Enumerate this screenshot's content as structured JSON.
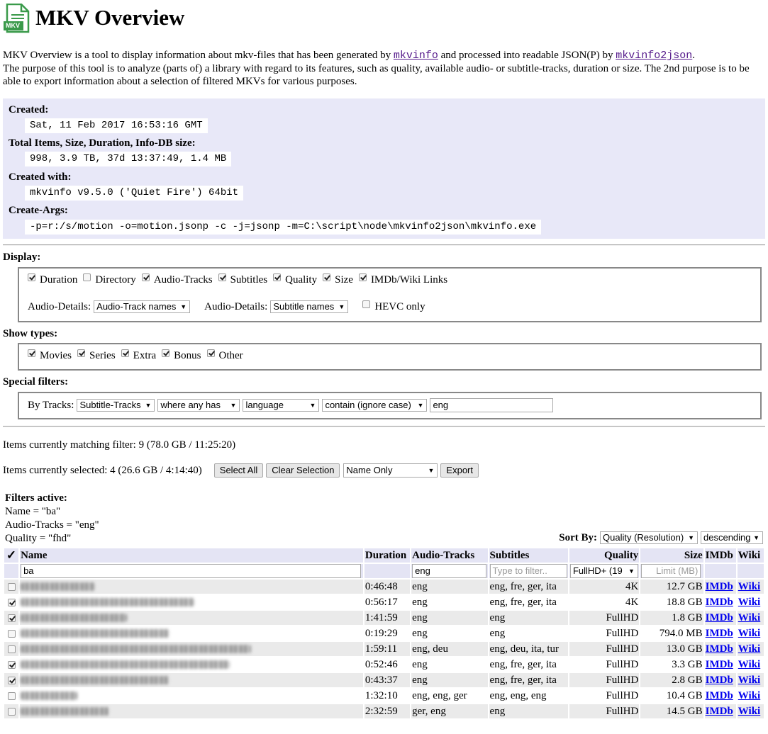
{
  "header": {
    "logo_text": "MKV",
    "title": "MKV Overview"
  },
  "intro": {
    "line1_prefix": "MKV Overview is a tool to display information about mkv-files that has been generated by ",
    "link1": "mkvinfo",
    "line1_mid": " and processed into readable JSON(P) by ",
    "link2": "mkvinfo2json",
    "line1_suffix": ".",
    "line2": "The purpose of this tool is to analyze (parts of) a library with regard to its features, such as quality, available audio- or subtitle-tracks, duration or size. The 2nd purpose is to be able to export information about a selection of filtered MKVs for various purposes."
  },
  "meta": {
    "created_label": "Created:",
    "created_value": "Sat, 11 Feb 2017 16:53:16 GMT",
    "totals_label": "Total Items, Size, Duration, Info-DB size:",
    "totals_value": "998, 3.9 TB, 37d 13:37:49, 1.4 MB",
    "with_label": "Created with:",
    "with_value": "mkvinfo v9.5.0 ('Quiet Fire') 64bit",
    "args_label": "Create-Args:",
    "args_value": "-p=r:/s/motion -o=motion.jsonp -c -j=jsonp -m=C:\\script\\node\\mkvinfo2json\\mkvinfo.exe"
  },
  "display": {
    "title": "Display:",
    "checks": [
      {
        "label": "Duration",
        "checked": true
      },
      {
        "label": "Directory",
        "checked": false
      },
      {
        "label": "Audio-Tracks",
        "checked": true
      },
      {
        "label": "Subtitles",
        "checked": true
      },
      {
        "label": "Quality",
        "checked": true
      },
      {
        "label": "Size",
        "checked": true
      },
      {
        "label": "IMDb/Wiki Links",
        "checked": true
      }
    ],
    "audio_details_label": "Audio-Details:",
    "audio_details_value": "Audio-Track names",
    "sub_details_label": "Audio-Details:",
    "sub_details_value": "Subtitle names",
    "hevc_label": "HEVC only"
  },
  "types": {
    "title": "Show types:",
    "checks": [
      {
        "label": "Movies",
        "checked": true
      },
      {
        "label": "Series",
        "checked": true
      },
      {
        "label": "Extra",
        "checked": true
      },
      {
        "label": "Bonus",
        "checked": true
      },
      {
        "label": "Other",
        "checked": true
      }
    ]
  },
  "special": {
    "title": "Special filters:",
    "by_label": "By Tracks:",
    "track_type": "Subtitle-Tracks",
    "where": "where any has",
    "field": "language",
    "op": "contain (ignore case)",
    "value": "eng"
  },
  "status": {
    "matching": "Items currently matching filter: 9 (78.0 GB / 11:25:20)",
    "selected": "Items currently selected: 4 (26.6 GB / 4:14:40)",
    "select_all": "Select All",
    "clear_selection": "Clear Selection",
    "export_mode": "Name Only",
    "export": "Export"
  },
  "filters_active": {
    "title": "Filters active:",
    "lines": [
      "Name = \"ba\"",
      "Audio-Tracks = \"eng\"",
      "Quality = \"fhd\""
    ]
  },
  "sort": {
    "label": "Sort By:",
    "field": "Quality (Resolution)",
    "order": "descending"
  },
  "table": {
    "check_header": "✓",
    "headers": {
      "name": "Name",
      "duration": "Duration",
      "audio": "Audio-Tracks",
      "subs": "Subtitles",
      "quality": "Quality",
      "size": "Size",
      "imdb": "IMDb",
      "wiki": "Wiki"
    },
    "filter": {
      "name": "ba",
      "audio": "eng",
      "subs_placeholder": "Type to filter..",
      "quality": "FullHD+ (19",
      "size_placeholder": "Limit (MB)"
    },
    "link_imdb": "IMDb",
    "link_wiki": "Wiki",
    "rows": [
      {
        "checked": false,
        "duration": "0:46:48",
        "audio": "eng",
        "subs": "eng, fre, ger, ita",
        "quality": "4K",
        "size": "12.7 GB"
      },
      {
        "checked": true,
        "duration": "0:56:17",
        "audio": "eng",
        "subs": "eng, fre, ger, ita",
        "quality": "4K",
        "size": "18.8 GB"
      },
      {
        "checked": true,
        "duration": "1:41:59",
        "audio": "eng",
        "subs": "eng",
        "quality": "FullHD",
        "size": "1.8 GB"
      },
      {
        "checked": false,
        "duration": "0:19:29",
        "audio": "eng",
        "subs": "eng",
        "quality": "FullHD",
        "size": "794.0 MB"
      },
      {
        "checked": false,
        "duration": "1:59:11",
        "audio": "eng, deu",
        "subs": "eng, deu, ita, tur",
        "quality": "FullHD",
        "size": "13.0 GB"
      },
      {
        "checked": true,
        "duration": "0:52:46",
        "audio": "eng",
        "subs": "eng, fre, ger, ita",
        "quality": "FullHD",
        "size": "3.3 GB"
      },
      {
        "checked": true,
        "duration": "0:43:37",
        "audio": "eng",
        "subs": "eng, fre, ger, ita",
        "quality": "FullHD",
        "size": "2.8 GB"
      },
      {
        "checked": false,
        "duration": "1:32:10",
        "audio": "eng, eng, ger",
        "subs": "eng, eng, eng",
        "quality": "FullHD",
        "size": "10.4 GB"
      },
      {
        "checked": false,
        "duration": "2:32:59",
        "audio": "ger, eng",
        "subs": "eng",
        "quality": "FullHD",
        "size": "14.5 GB"
      }
    ]
  }
}
